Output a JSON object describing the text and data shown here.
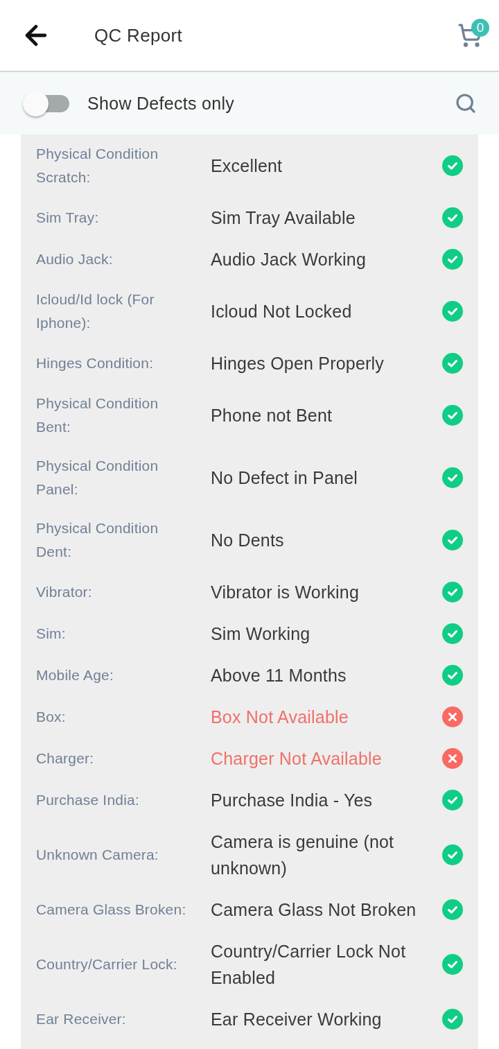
{
  "header": {
    "title": "QC Report",
    "cart_count": "0"
  },
  "filter": {
    "label": "Show Defects only",
    "on": false
  },
  "rows": [
    {
      "label": "Physical Condition Scratch:",
      "value": "Excellent",
      "defect": false
    },
    {
      "label": "Sim Tray:",
      "value": "Sim Tray Available",
      "defect": false
    },
    {
      "label": "Audio Jack:",
      "value": "Audio Jack Working",
      "defect": false
    },
    {
      "label": "Icloud/Id lock (For Iphone):",
      "value": "Icloud Not Locked",
      "defect": false
    },
    {
      "label": "Hinges Condition:",
      "value": "Hinges Open Properly",
      "defect": false
    },
    {
      "label": "Physical Condition Bent:",
      "value": "Phone not Bent",
      "defect": false
    },
    {
      "label": "Physical Condition Panel:",
      "value": "No Defect in Panel",
      "defect": false
    },
    {
      "label": "Physical Condition Dent:",
      "value": "No Dents",
      "defect": false
    },
    {
      "label": "Vibrator:",
      "value": "Vibrator is Working",
      "defect": false
    },
    {
      "label": "Sim:",
      "value": "Sim Working",
      "defect": false
    },
    {
      "label": "Mobile Age:",
      "value": "Above 11 Months",
      "defect": false
    },
    {
      "label": "Box:",
      "value": "Box Not Available",
      "defect": true
    },
    {
      "label": "Charger:",
      "value": "Charger Not Available",
      "defect": true
    },
    {
      "label": "Purchase India:",
      "value": "Purchase India - Yes",
      "defect": false
    },
    {
      "label": "Unknown Camera:",
      "value": "Camera is genuine (not unknown)",
      "defect": false
    },
    {
      "label": "Camera Glass Broken:",
      "value": "Camera Glass Not Broken",
      "defect": false
    },
    {
      "label": "Country/Carrier Lock:",
      "value": "Country/Carrier Lock Not Enabled",
      "defect": false
    },
    {
      "label": "Ear Receiver:",
      "value": "Ear Receiver Working",
      "defect": false
    }
  ]
}
